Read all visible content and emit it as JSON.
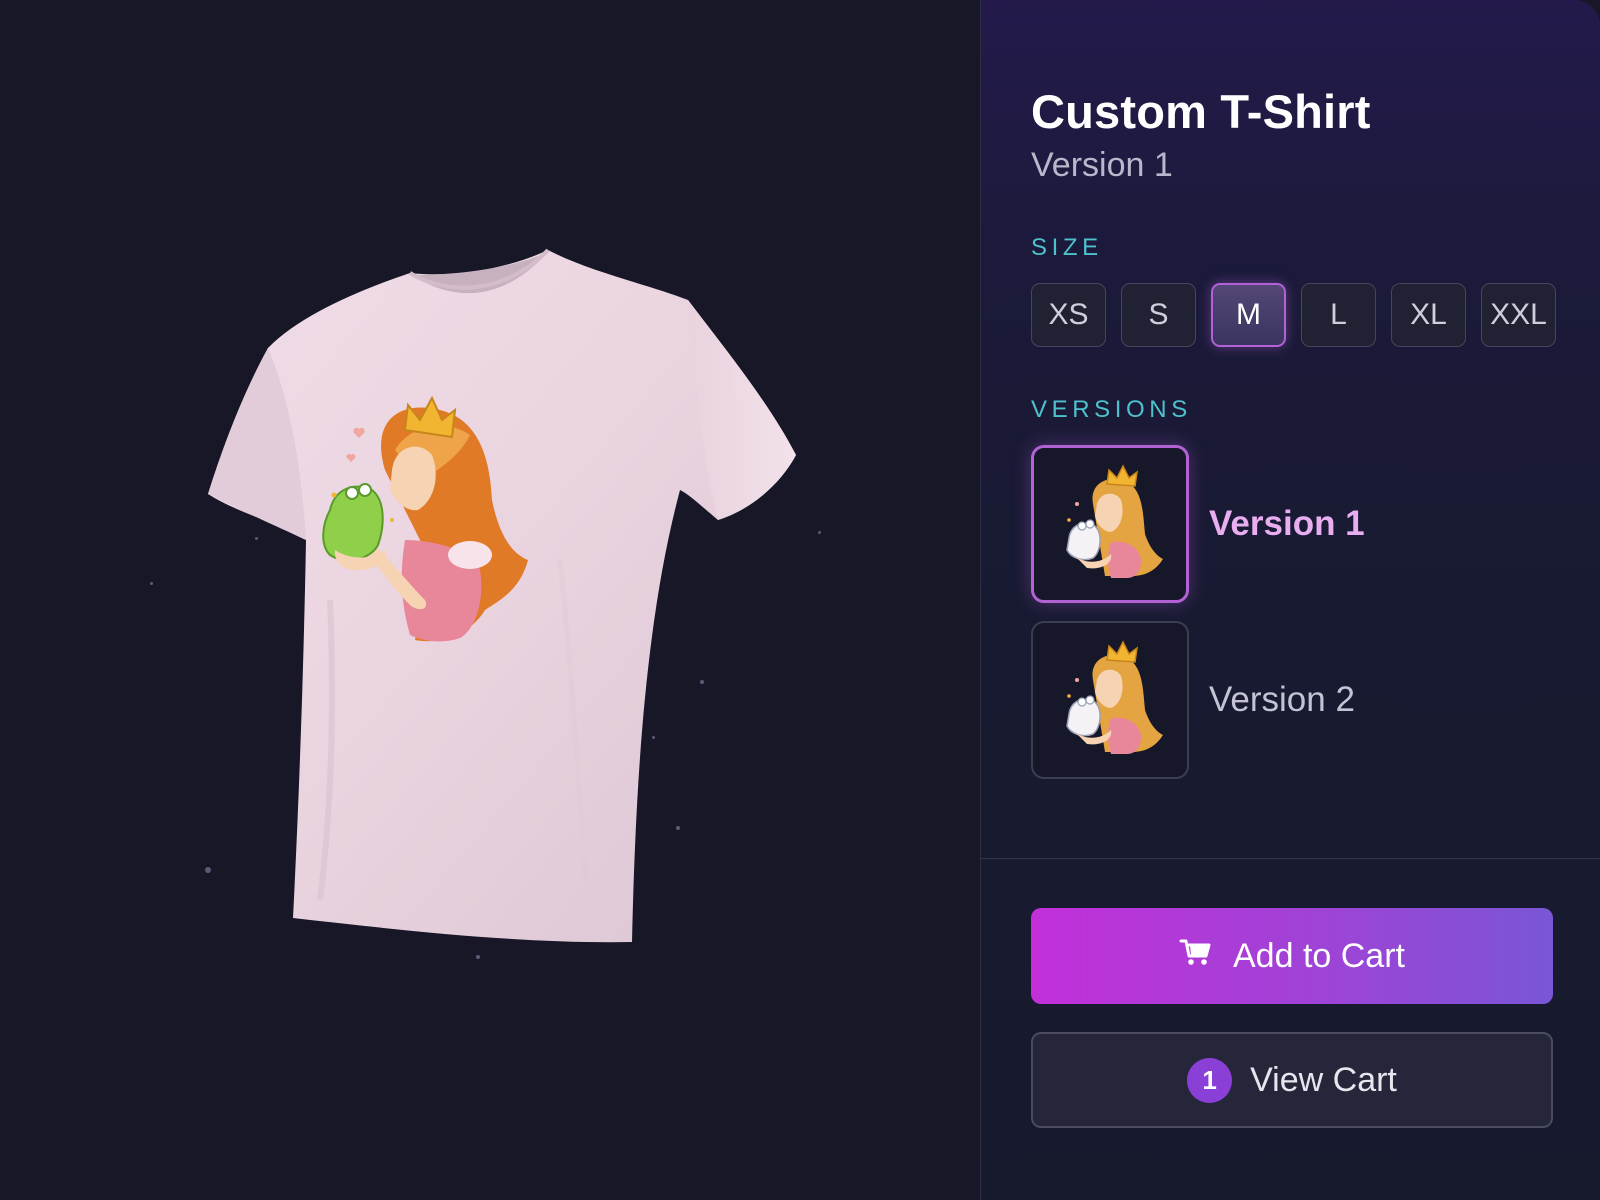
{
  "product": {
    "title": "Custom T-Shirt",
    "subtitle": "Version 1"
  },
  "size": {
    "label": "SIZE",
    "options": [
      "XS",
      "S",
      "M",
      "L",
      "XL",
      "XXL"
    ],
    "selected": "M"
  },
  "versions": {
    "label": "VERSIONS",
    "items": [
      {
        "label": "Version 1",
        "selected": true
      },
      {
        "label": "Version 2",
        "selected": false
      }
    ]
  },
  "actions": {
    "add_to_cart": "Add to Cart",
    "view_cart": "View Cart",
    "cart_count": "1"
  },
  "icons": {
    "add_to_cart": "cart-icon",
    "product_preview": "tshirt-3d-preview",
    "design": "princess-frog-illustration"
  },
  "colors": {
    "accent": "#b362d6",
    "section_label": "#4fc1cd",
    "shirt": "#ebd6e2",
    "background": "#171727"
  }
}
